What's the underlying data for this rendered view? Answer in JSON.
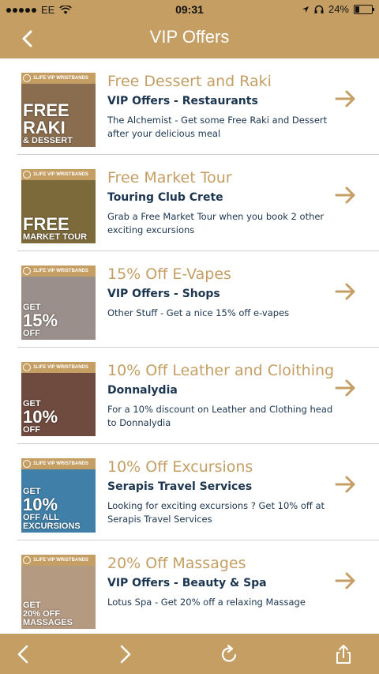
{
  "status_bar": {
    "carrier": "EE",
    "time": "09:31",
    "battery": "24%",
    "battery_fraction": 0.24
  },
  "nav": {
    "title": "VIP Offers",
    "back_icon": "chevron-left-icon"
  },
  "offers": [
    {
      "title": "Free Dessert and Raki",
      "subtitle": "VIP Offers - Restaurants",
      "description": "The Alchemist - Get some Free Raki and Dessert after your delicious meal",
      "thumb_banner": "1LIFE VIP WRISTBANDS",
      "thumb_text": [
        "FREE",
        "RAKI",
        "& DESSERT"
      ],
      "thumb_color": "#8a6d4e"
    },
    {
      "title": "Free Market Tour",
      "subtitle": "Touring Club Crete",
      "description": "Grab a Free Market Tour when you book 2 other exciting excursions",
      "thumb_banner": "1LIFE VIP WRISTBANDS",
      "thumb_text": [
        "FREE",
        "MARKET TOUR"
      ],
      "thumb_color": "#7d6a3a"
    },
    {
      "title": "15% Off E-Vapes",
      "subtitle": "VIP Offers - Shops",
      "description": "Other Stuff - Get a nice 15% off e-vapes",
      "thumb_banner": "1LIFE VIP WRISTBANDS",
      "thumb_text": [
        "GET",
        "15%",
        "OFF"
      ],
      "thumb_color": "#9a8f8a"
    },
    {
      "title": "10% Off Leather and Cloithing",
      "subtitle": "Donnalydia",
      "description": "For a 10% discount on Leather and Clothing head to Donnalydia",
      "thumb_banner": "1LIFE VIP WRISTBANDS",
      "thumb_text": [
        "GET",
        "10%",
        "OFF"
      ],
      "thumb_color": "#6f4a3e"
    },
    {
      "title": "10% Off Excursions",
      "subtitle": "Serapis Travel Services",
      "description": "Looking for exciting excursions ? Get 10% off at Serapis Travel Services",
      "thumb_banner": "1LIFE VIP WRISTBANDS",
      "thumb_text": [
        "GET",
        "10%",
        "OFF ALL",
        "EXCURSIONS"
      ],
      "thumb_color": "#3f7fa8"
    },
    {
      "title": "20% Off Massages",
      "subtitle": "VIP Offers - Beauty & Spa",
      "description": "Lotus Spa - Get 20% off a relaxing Massage",
      "thumb_banner": "1LIFE VIP WRISTBANDS",
      "thumb_text": [
        "GET",
        "20% OFF",
        "MASSAGES"
      ],
      "thumb_color": "#b59a82"
    }
  ],
  "toolbar": {
    "icons": [
      "chevron-left-icon",
      "chevron-right-icon",
      "refresh-icon",
      "share-icon"
    ]
  },
  "colors": {
    "accent": "#c59e64",
    "title": "#c59e64",
    "subtitle": "#1b3550"
  }
}
